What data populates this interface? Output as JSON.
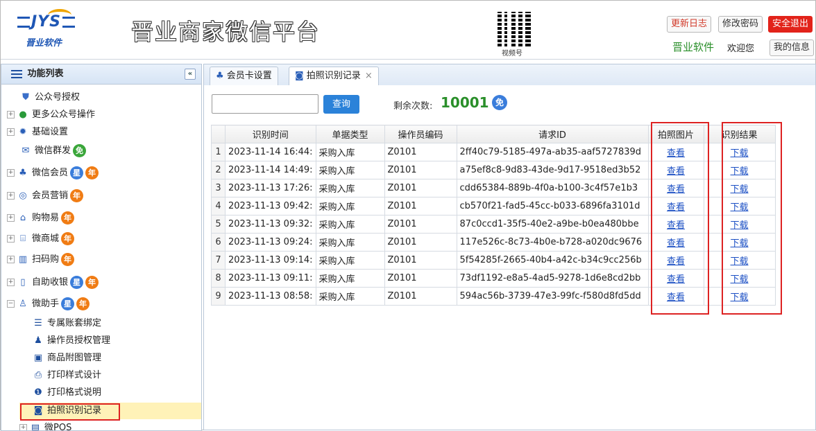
{
  "header": {
    "logo_text": "JYS",
    "logo_sub": "晋业软件",
    "title": "晋业商家微信平台",
    "qr_label": "视频号",
    "btn_changelog": "更新日志",
    "btn_change_password": "修改密码",
    "btn_logout": "安全退出",
    "company": "晋业软件",
    "welcome": "欢迎您",
    "btn_my_info": "我的信息"
  },
  "sidebar": {
    "title": "功能列表",
    "collapse_label": "«",
    "items": [
      {
        "label": "公众号授权",
        "icon": "shield-check-icon"
      },
      {
        "label": "更多公众号操作",
        "icon": "wechat-icon"
      },
      {
        "label": "基础设置",
        "icon": "gear-icon"
      },
      {
        "label": "微信群发",
        "icon": "mail-icon",
        "badges": [
          "免"
        ]
      },
      {
        "label": "微信会员",
        "icon": "members-icon",
        "badges": [
          "星",
          "年"
        ]
      },
      {
        "label": "会员营销",
        "icon": "person-circle-icon",
        "badges": [
          "年"
        ]
      },
      {
        "label": "购物易",
        "icon": "shopping-icon",
        "badges": [
          "年"
        ]
      },
      {
        "label": "微商城",
        "icon": "store-icon",
        "badges": [
          "年"
        ]
      },
      {
        "label": "扫码购",
        "icon": "barcode-icon",
        "badges": [
          "年"
        ]
      },
      {
        "label": "自助收银",
        "icon": "tablet-icon",
        "badges": [
          "星",
          "年"
        ]
      },
      {
        "label": "微助手",
        "icon": "person-icon",
        "badges": [
          "星",
          "年"
        ]
      },
      {
        "label": "专属账套绑定",
        "icon": "database-icon"
      },
      {
        "label": "操作员授权管理",
        "icon": "users-icon"
      },
      {
        "label": "商品附图管理",
        "icon": "image-icon"
      },
      {
        "label": "打印样式设计",
        "icon": "printer-icon"
      },
      {
        "label": "打印格式说明",
        "icon": "info-icon"
      },
      {
        "label": "拍照识别记录",
        "icon": "camera-icon"
      },
      {
        "label": "微POS",
        "icon": "pos-icon"
      }
    ]
  },
  "tabs": [
    {
      "label": "会员卡设置",
      "icon": "members-icon"
    },
    {
      "label": "拍照识别记录",
      "icon": "camera-icon",
      "close": "×"
    }
  ],
  "toolbar": {
    "search_placeholder": "",
    "query_label": "查询",
    "remain_label": "剩余次数:",
    "remain_value": "10001",
    "remain_badge": "免"
  },
  "table": {
    "columns": [
      "",
      "识别时间",
      "单据类型",
      "操作员编码",
      "请求ID",
      "拍照图片",
      "识别结果"
    ],
    "rows": [
      {
        "n": "1",
        "time": "2023-11-14 16:44:",
        "type": "采购入库",
        "op": "Z0101",
        "id": "2ff40c79-5185-497a-ab35-aaf5727839d",
        "img": "查看",
        "res": "下载"
      },
      {
        "n": "2",
        "time": "2023-11-14 14:49:",
        "type": "采购入库",
        "op": "Z0101",
        "id": "a75ef8c8-9d83-43de-9d17-9518ed3b52",
        "img": "查看",
        "res": "下载"
      },
      {
        "n": "3",
        "time": "2023-11-13 17:26:",
        "type": "采购入库",
        "op": "Z0101",
        "id": "cdd65384-889b-4f0a-b100-3c4f57e1b3",
        "img": "查看",
        "res": "下载"
      },
      {
        "n": "4",
        "time": "2023-11-13 09:42:",
        "type": "采购入库",
        "op": "Z0101",
        "id": "cb570f21-fad5-45cc-b033-6896fa3101d",
        "img": "查看",
        "res": "下载"
      },
      {
        "n": "5",
        "time": "2023-11-13 09:32:",
        "type": "采购入库",
        "op": "Z0101",
        "id": "87c0ccd1-35f5-40e2-a9be-b0ea480bbe",
        "img": "查看",
        "res": "下载"
      },
      {
        "n": "6",
        "time": "2023-11-13 09:24:",
        "type": "采购入库",
        "op": "Z0101",
        "id": "117e526c-8c73-4b0e-b728-a020dc9676",
        "img": "查看",
        "res": "下载"
      },
      {
        "n": "7",
        "time": "2023-11-13 09:14:",
        "type": "采购入库",
        "op": "Z0101",
        "id": "5f54285f-2665-40b4-a42c-b34c9cc256b",
        "img": "查看",
        "res": "下载"
      },
      {
        "n": "8",
        "time": "2023-11-13 09:11:",
        "type": "采购入库",
        "op": "Z0101",
        "id": "73df1192-e8a5-4ad5-9278-1d6e8cd2bb",
        "img": "查看",
        "res": "下载"
      },
      {
        "n": "9",
        "time": "2023-11-13 08:58:",
        "type": "采购入库",
        "op": "Z0101",
        "id": "594ac56b-3739-47e3-99fc-f580d8fd5dd",
        "img": "查看",
        "res": "下载"
      }
    ]
  },
  "colors": {
    "accent": "#2b82d9",
    "logout": "#e2231a",
    "highlight": "#d22222"
  }
}
